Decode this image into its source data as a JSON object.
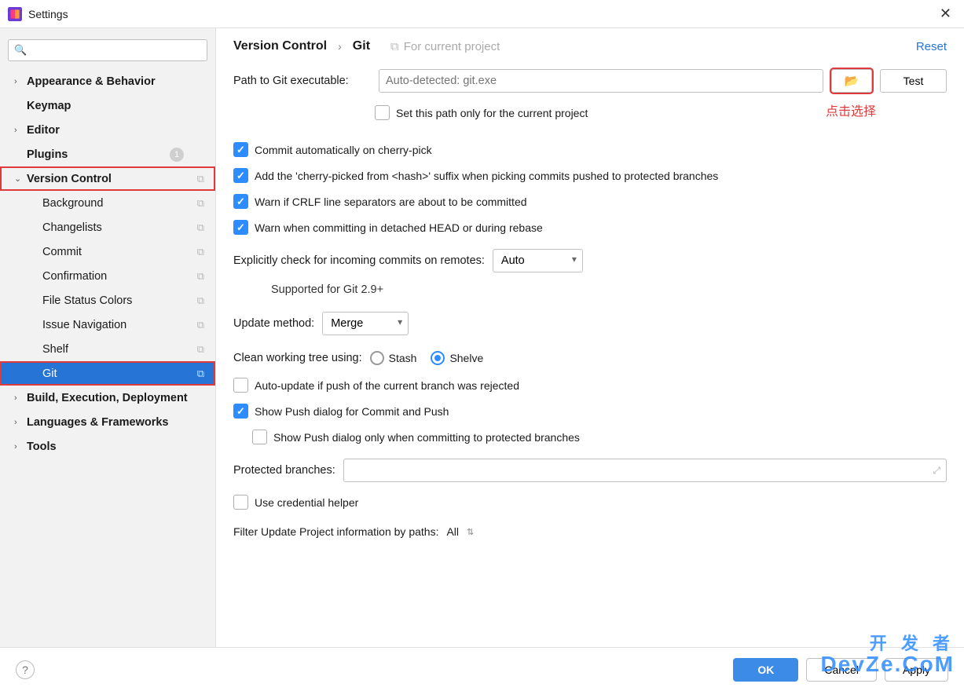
{
  "window": {
    "title": "Settings"
  },
  "sidebar": {
    "search_placeholder": "",
    "items": [
      {
        "label": "Appearance & Behavior",
        "bold": true,
        "expandable": true
      },
      {
        "label": "Keymap",
        "bold": true
      },
      {
        "label": "Editor",
        "bold": true,
        "expandable": true
      },
      {
        "label": "Plugins",
        "bold": true,
        "badge": "1"
      },
      {
        "label": "Version Control",
        "bold": true,
        "expandable": true,
        "expanded": true,
        "copy": true,
        "outlined": true
      },
      {
        "label": "Background",
        "child": true,
        "copy": true
      },
      {
        "label": "Changelists",
        "child": true,
        "copy": true
      },
      {
        "label": "Commit",
        "child": true,
        "copy": true
      },
      {
        "label": "Confirmation",
        "child": true,
        "copy": true
      },
      {
        "label": "File Status Colors",
        "child": true,
        "copy": true
      },
      {
        "label": "Issue Navigation",
        "child": true,
        "copy": true
      },
      {
        "label": "Shelf",
        "child": true,
        "copy": true
      },
      {
        "label": "Git",
        "child": true,
        "copy": true,
        "selected": true,
        "outlined": true
      },
      {
        "label": "Build, Execution, Deployment",
        "bold": true,
        "expandable": true
      },
      {
        "label": "Languages & Frameworks",
        "bold": true,
        "expandable": true
      },
      {
        "label": "Tools",
        "bold": true,
        "expandable": true
      }
    ]
  },
  "breadcrumb": {
    "a": "Version Control",
    "b": "Git",
    "scope": "For current project",
    "reset": "Reset"
  },
  "git": {
    "path_label": "Path to Git executable:",
    "path_placeholder": "Auto-detected: git.exe",
    "test": "Test",
    "red_note": "点击选择",
    "set_path_current": "Set this path only for the current project",
    "cb_cherry": "Commit automatically on cherry-pick",
    "cb_suffix": "Add the 'cherry-picked from <hash>' suffix when picking commits pushed to protected branches",
    "cb_crlf": "Warn if CRLF line separators are about to be committed",
    "cb_detached": "Warn when committing in detached HEAD or during rebase",
    "explicit_label": "Explicitly check for incoming commits on remotes:",
    "explicit_value": "Auto",
    "hint29": "Supported for Git 2.9+",
    "update_label": "Update method:",
    "update_value": "Merge",
    "clean_label": "Clean working tree using:",
    "radio_stash": "Stash",
    "radio_shelve": "Shelve",
    "cb_autoupdate": "Auto-update if push of the current branch was rejected",
    "cb_showpush": "Show Push dialog for Commit and Push",
    "cb_showpush_protected": "Show Push dialog only when committing to protected branches",
    "protected_label": "Protected branches:",
    "cb_credhelper": "Use credential helper",
    "filter_label": "Filter Update Project information by paths:",
    "filter_value": "All"
  },
  "footer": {
    "ok": "OK",
    "cancel": "Cancel",
    "apply": "Apply"
  },
  "watermark": {
    "sub": "开 发 者",
    "main": "DevZe.CoM"
  }
}
